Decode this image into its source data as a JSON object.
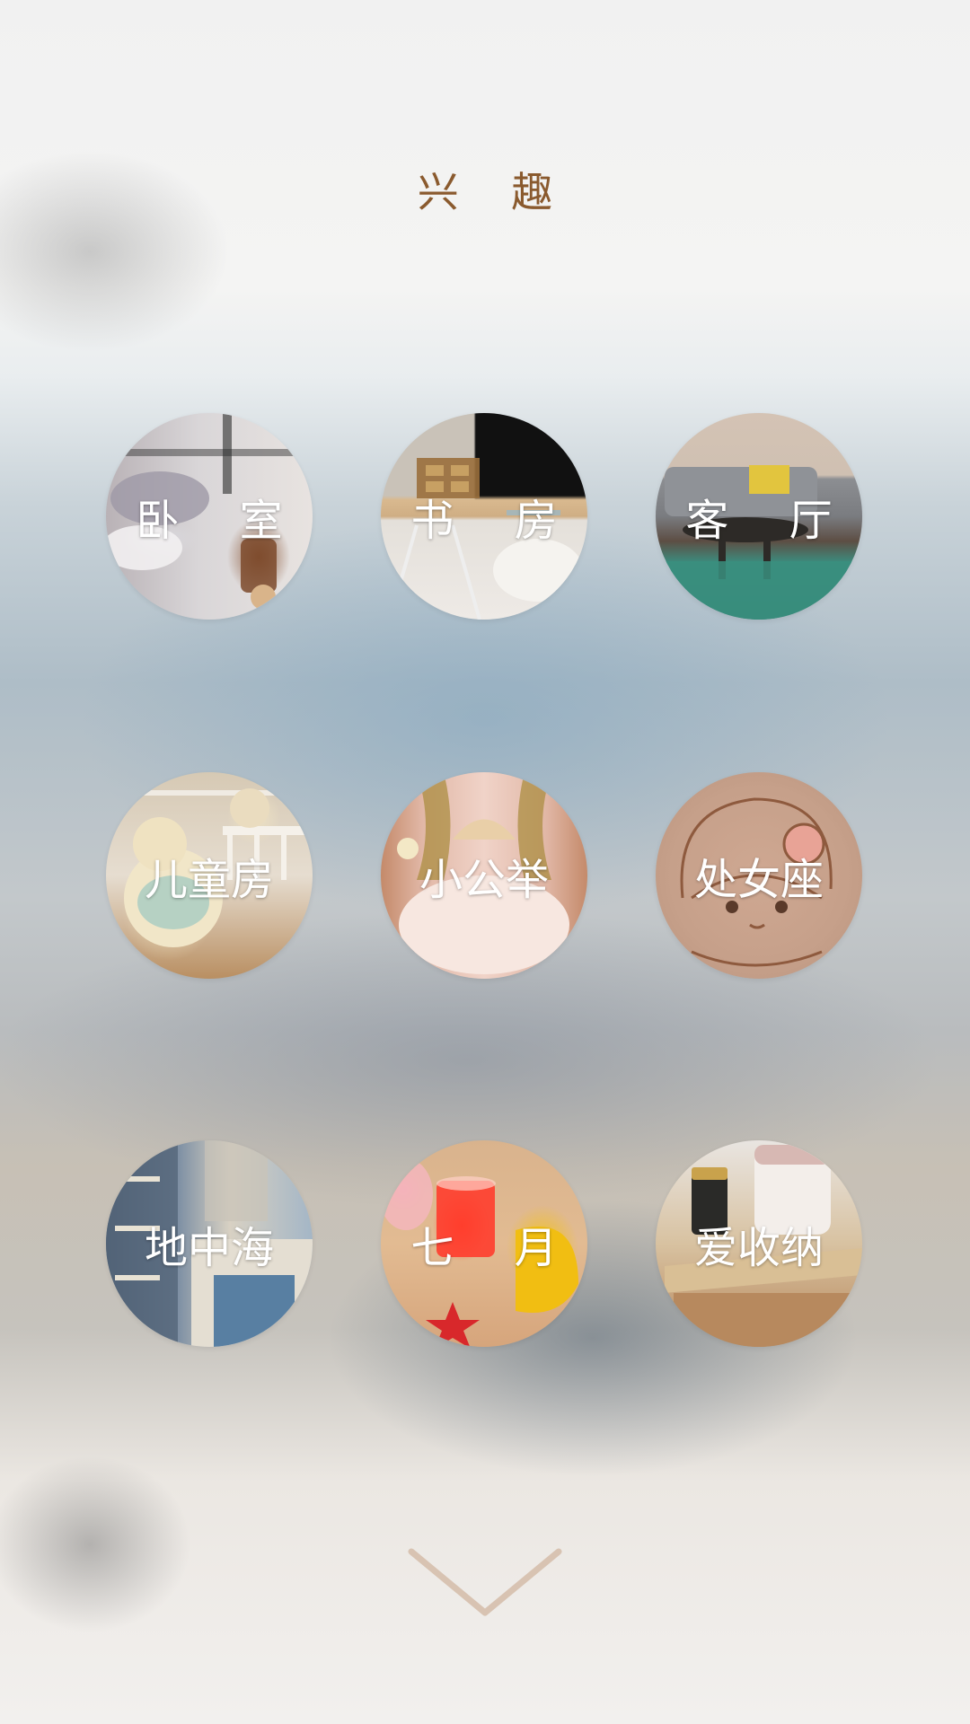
{
  "page": {
    "title": "兴 趣"
  },
  "tiles": [
    {
      "label": "卧 室"
    },
    {
      "label": "书 房"
    },
    {
      "label": "客 厅"
    },
    {
      "label": "儿童房"
    },
    {
      "label": "小公举"
    },
    {
      "label": "处女座"
    },
    {
      "label": "地中海"
    },
    {
      "label": "七 月"
    },
    {
      "label": "爱收纳"
    }
  ],
  "icons": {
    "next": "chevron-down-icon"
  },
  "colors": {
    "title": "#8a5a2e",
    "label": "#ffffff",
    "chevron": "#d8c3b2"
  }
}
